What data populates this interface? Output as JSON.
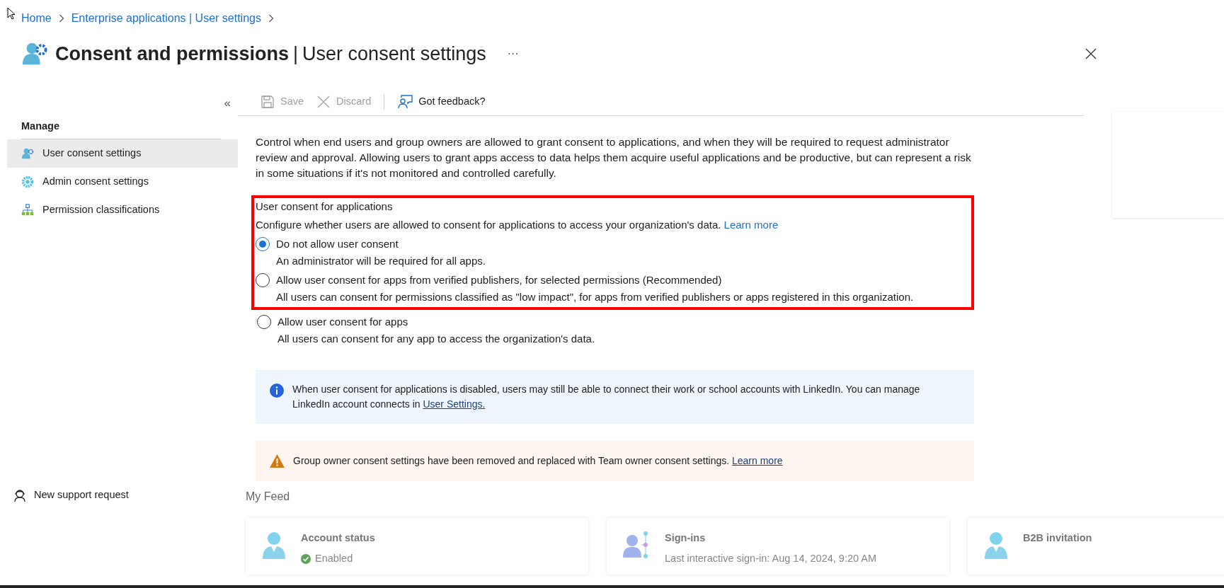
{
  "breadcrumb": [
    "Home",
    "Enterprise applications | User settings"
  ],
  "title": {
    "main": "Consent and permissions",
    "divider": "|",
    "sub": "User consent settings",
    "more": "···"
  },
  "sidebar": {
    "collapse": "«",
    "section": "Manage",
    "items": [
      {
        "label": "User consent settings",
        "kind": "user-gear",
        "selected": true
      },
      {
        "label": "Admin consent settings",
        "kind": "gear",
        "selected": false
      },
      {
        "label": "Permission classifications",
        "kind": "hierarchy",
        "selected": false
      }
    ],
    "footer": "New support request"
  },
  "toolbar": [
    {
      "label": "Save",
      "kind": "save",
      "disabled": true
    },
    {
      "label": "Discard",
      "kind": "discard",
      "disabled": true
    },
    {
      "label": "Got feedback?",
      "kind": "feedback",
      "disabled": false
    }
  ],
  "intro": "Control when end users and group owners are allowed to grant consent to applications, and when they will be required to request administrator review and approval. Allowing users to grant apps access to data helps them acquire useful applications and be productive, but can represent a risk in some situations if it's not monitored and controlled carefully.",
  "user_consent": {
    "heading": "User consent for applications",
    "description": "Configure whether users are allowed to consent for applications to access your organization's data.",
    "link": "Learn more",
    "options": [
      {
        "label": "Do not allow user consent",
        "detail": "An administrator will be required for all apps.",
        "selected": true,
        "highlighted": true
      },
      {
        "label": "Allow user consent for apps from verified publishers, for selected permissions (Recommended)",
        "detail": "All users can consent for permissions classified as \"low impact\", for apps from verified publishers or apps registered in this organization.",
        "selected": false,
        "highlighted": true
      },
      {
        "label": "Allow user consent for apps",
        "detail": "All users can consent for any app to access the organization's data.",
        "selected": false,
        "highlighted": false
      }
    ]
  },
  "notices": [
    {
      "kind": "info",
      "text": "When user consent for applications is disabled, users may still be able to connect their work or school accounts with LinkedIn. You can manage LinkedIn account connects in",
      "link": "User Settings."
    },
    {
      "kind": "warning",
      "text": "Group owner consent settings have been removed and replaced with Team owner consent settings.",
      "link": "Learn more"
    }
  ],
  "feed": {
    "title": "My Feed",
    "cards": [
      {
        "title": "Account status",
        "kind": "status",
        "detail": "Enabled"
      },
      {
        "title": "Sign-ins",
        "kind": "signins",
        "detail": "Last interactive sign-in: Aug 14, 2024, 9:20 AM"
      },
      {
        "title": "B2B invitation",
        "kind": "person"
      }
    ]
  }
}
